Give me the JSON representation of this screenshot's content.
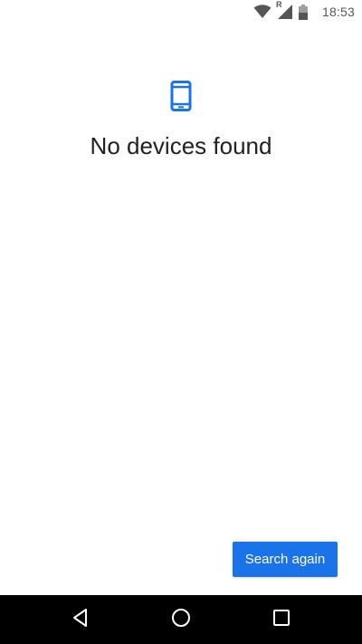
{
  "status_bar": {
    "time": "18:53",
    "roaming_indicator": "R",
    "icons": [
      "wifi-icon",
      "cell-signal-icon",
      "battery-icon"
    ]
  },
  "empty_state": {
    "icon": "smartphone-icon",
    "title": "No devices found"
  },
  "actions": {
    "search_again_label": "Search again"
  },
  "nav_bar": {
    "buttons": [
      "back-icon",
      "home-icon",
      "recents-icon"
    ]
  },
  "colors": {
    "accent": "#1a73e8",
    "title_text": "#212121",
    "status_icons": "#555555",
    "nav_background": "#000000"
  }
}
